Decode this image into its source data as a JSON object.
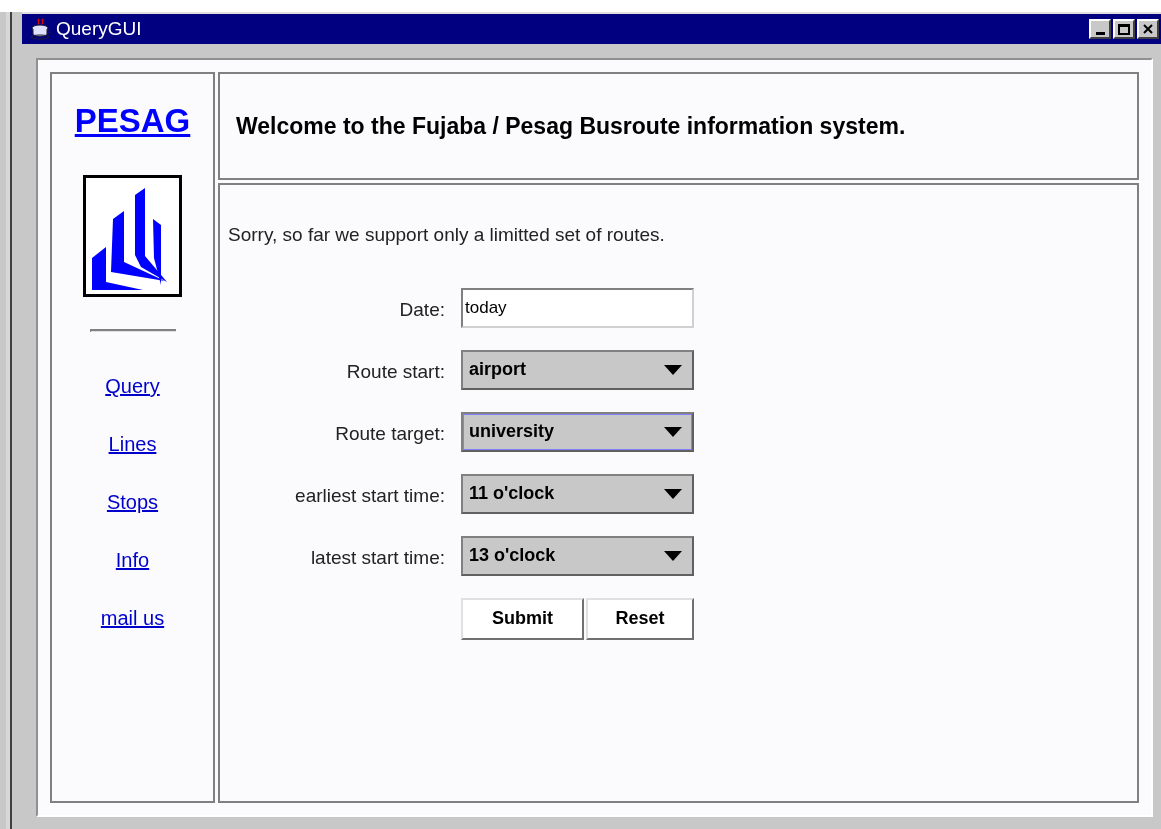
{
  "window": {
    "title": "QueryGUI"
  },
  "sidebar": {
    "brand": "PESAG",
    "links": [
      "Query",
      "Lines",
      "Stops",
      "Info",
      "mail us"
    ]
  },
  "header": {
    "title": "Welcome to the Fujaba / Pesag Busroute information system."
  },
  "notice": "Sorry, so far we support only a limitted set of routes.",
  "form": {
    "fields": [
      {
        "kind": "text",
        "label": "Date:",
        "value": "today",
        "focused": false
      },
      {
        "kind": "dropdown",
        "label": "Route start:",
        "value": "airport",
        "focused": false
      },
      {
        "kind": "dropdown",
        "label": "Route target:",
        "value": "university",
        "focused": true
      },
      {
        "kind": "dropdown",
        "label": "earliest start time:",
        "value": "11 o'clock",
        "focused": false
      },
      {
        "kind": "dropdown",
        "label": "latest start time:",
        "value": "13 o'clock",
        "focused": false
      }
    ],
    "buttons": [
      "Submit",
      "Reset"
    ]
  }
}
